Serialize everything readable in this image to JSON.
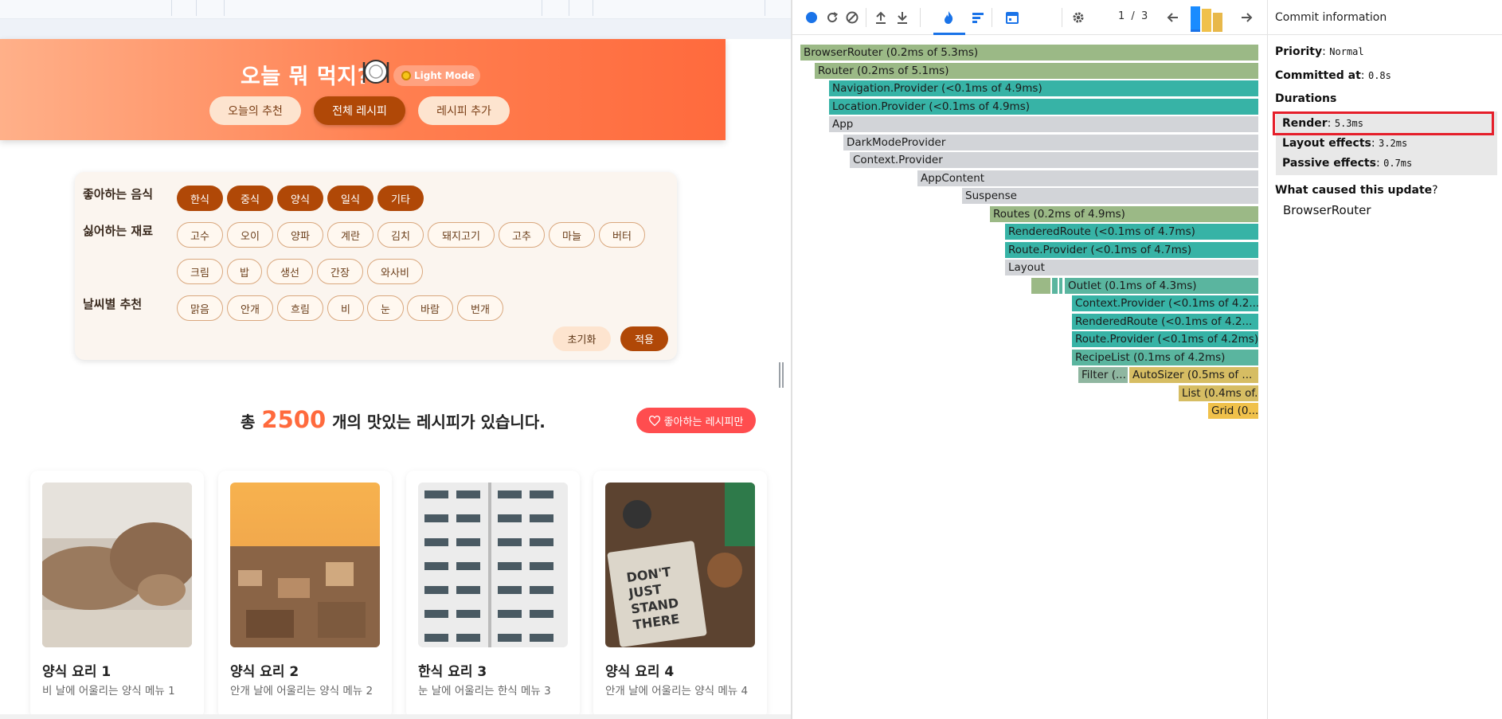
{
  "app": {
    "title": "오늘 뭐 먹지?",
    "mode_toggle": "Light Mode",
    "nav": {
      "today": "오늘의 추천",
      "all": "전체 레시피",
      "add": "레시피 추가"
    },
    "filters": {
      "favorite_label": "좋아하는 음식",
      "favorite_options": [
        "한식",
        "중식",
        "양식",
        "일식",
        "기타"
      ],
      "dislike_label": "싫어하는 재료",
      "dislike_options": [
        "고수",
        "오이",
        "양파",
        "계란",
        "김치",
        "돼지고기",
        "고추",
        "마늘",
        "버터",
        "크림",
        "밥",
        "생선",
        "간장",
        "와사비"
      ],
      "weather_label": "날씨별 추천",
      "weather_options": [
        "맑음",
        "안개",
        "흐림",
        "비",
        "눈",
        "바람",
        "번개"
      ],
      "reset": "초기화",
      "apply": "적용"
    },
    "count": {
      "prefix": "총",
      "number": "2500",
      "suffix": "개의 맛있는 레시피가 있습니다."
    },
    "favorites_only": "좋아하는 레시피만",
    "cards": [
      {
        "title": "양식 요리 1",
        "desc": "비 날에 어울리는 양식 메뉴 1",
        "image": "walrus-photo"
      },
      {
        "title": "양식 요리 2",
        "desc": "안개 날에 어울리는 양식 메뉴 2",
        "image": "city-sunset-photo"
      },
      {
        "title": "한식 요리 3",
        "desc": "눈 날에 어울리는 한식 메뉴 3",
        "image": "apartment-building-photo"
      },
      {
        "title": "양식 요리 4",
        "desc": "안개 날에 어울리는 양식 메뉴 4",
        "image": "notebook-desk-photo"
      }
    ]
  },
  "devtools": {
    "toolbar": {
      "icons": [
        "record-icon",
        "reload-icon",
        "clear-icon",
        "upload-icon",
        "download-icon",
        "flamegraph-icon",
        "ranked-icon",
        "timeline-icon",
        "settings-icon",
        "prev-commit-icon",
        "next-commit-icon"
      ],
      "commit_index": "1",
      "commit_sep": "/",
      "commit_total": "3",
      "commit_bars": [
        {
          "color": "#1a8cff",
          "level": 0.95
        },
        {
          "color": "#f0c14b",
          "level": 0.85
        },
        {
          "color": "#e8b84a",
          "level": 0.72
        }
      ]
    },
    "flamegraph": [
      {
        "label": "BrowserRouter (0.2ms of 5.3ms)",
        "color": "olive"
      },
      {
        "label": "Router (0.2ms of 5.1ms)",
        "color": "olive"
      },
      {
        "label": "Navigation.Provider (<0.1ms of 4.9ms)",
        "color": "teal"
      },
      {
        "label": "Location.Provider (<0.1ms of 4.9ms)",
        "color": "teal"
      },
      {
        "label": "App",
        "color": "grey"
      },
      {
        "label": "DarkModeProvider",
        "color": "grey"
      },
      {
        "label": "Context.Provider",
        "color": "grey"
      },
      {
        "label": "AppContent",
        "color": "grey"
      },
      {
        "label": "Suspense",
        "color": "grey"
      },
      {
        "label": "Routes (0.2ms of 4.9ms)",
        "color": "olive"
      },
      {
        "label": "RenderedRoute (<0.1ms of 4.7ms)",
        "color": "teal"
      },
      {
        "label": "Route.Provider (<0.1ms of 4.7ms)",
        "color": "teal"
      },
      {
        "label": "Layout",
        "color": "grey"
      },
      {
        "label": "Outlet (0.1ms of 4.3ms)",
        "color": "tealdk"
      },
      {
        "label": "Context.Provider (<0.1ms of 4.2...",
        "color": "teal"
      },
      {
        "label": "RenderedRoute (<0.1ms of 4.2...",
        "color": "teal"
      },
      {
        "label": "Route.Provider (<0.1ms of 4.2ms)",
        "color": "teal"
      },
      {
        "label": "RecipeList (0.1ms of 4.2ms)",
        "color": "tealdk"
      },
      {
        "label": "Filter (...",
        "color": "sage"
      },
      {
        "label": "AutoSizer (0.5ms of ...",
        "color": "mustard"
      },
      {
        "label": "List (0.4ms of...",
        "color": "mustard"
      },
      {
        "label": "Grid (0....",
        "color": "gold"
      }
    ],
    "side": {
      "header": "Commit information",
      "priority_label": "Priority",
      "priority_value": "Normal",
      "committed_label": "Committed at",
      "committed_value": "0.8s",
      "durations_label": "Durations",
      "render_label": "Render",
      "render_value": "5.3ms",
      "layout_label": "Layout effects",
      "layout_value": "3.2ms",
      "passive_label": "Passive effects",
      "passive_value": "0.7ms",
      "cause_label": "What caused this update",
      "cause_value": "BrowserRouter"
    }
  }
}
